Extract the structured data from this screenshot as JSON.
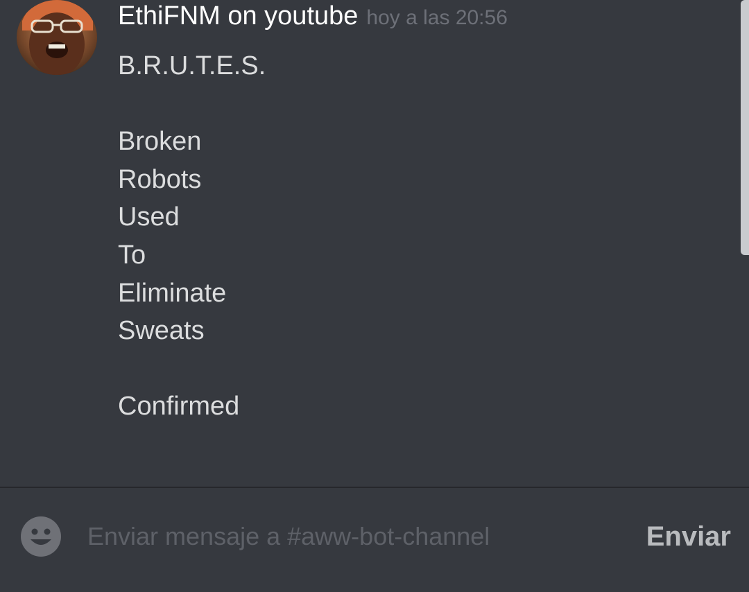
{
  "message": {
    "author": "EthiFNM on youtube",
    "timestamp": "hoy a las 20:56",
    "avatar_icon": "user-avatar",
    "lines": [
      "B.R.U.T.E.S.",
      "",
      "Broken",
      "Robots",
      "Used",
      "To",
      "Eliminate",
      "Sweats",
      "",
      "Confirmed"
    ]
  },
  "composer": {
    "placeholder": "Enviar mensaje a #aww-bot-channel",
    "value": "",
    "send_label": "Enviar",
    "emoji_icon": "smiley-face-icon"
  },
  "colors": {
    "background": "#36393f",
    "username": "#ffffff",
    "timestamp": "#6d7078",
    "message_text": "#dcddde",
    "placeholder": "#5e6168",
    "send_button": "#b9bbbe"
  }
}
